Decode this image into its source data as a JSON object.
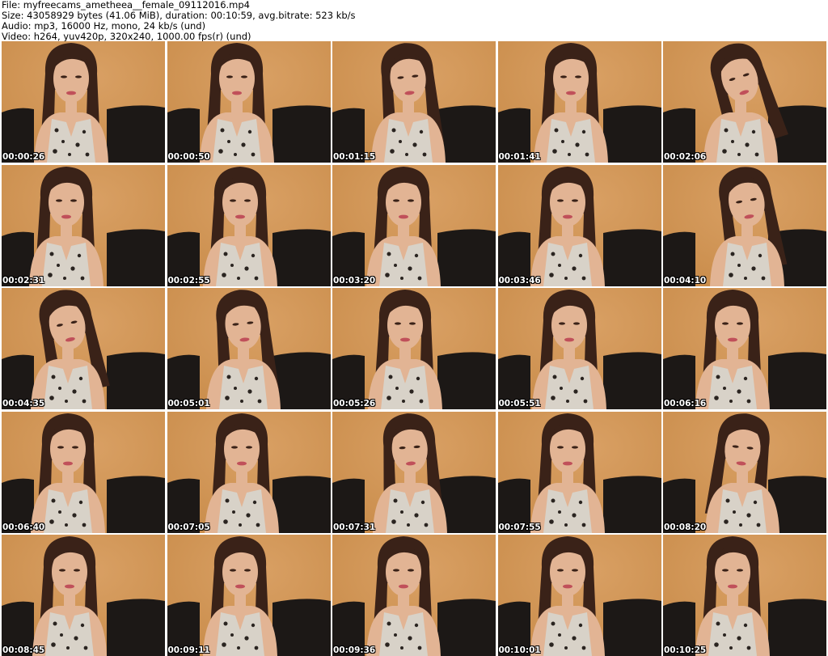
{
  "header": {
    "file_line": "File: myfreecams_ametheea__female_09112016.mp4",
    "size_line": "Size: 43058929 bytes (41.06 MiB), duration: 00:10:59, avg.bitrate: 523 kb/s",
    "audio_line": "Audio: mp3, 16000 Hz, mono, 24 kb/s (und)",
    "video_line": "Video: h264, yuv420p, 320x240, 1000.00 fps(r) (und)"
  },
  "frames": [
    {
      "timestamp": "00:00:26"
    },
    {
      "timestamp": "00:00:50"
    },
    {
      "timestamp": "00:01:15"
    },
    {
      "timestamp": "00:01:41"
    },
    {
      "timestamp": "00:02:06"
    },
    {
      "timestamp": "00:02:31"
    },
    {
      "timestamp": "00:02:55"
    },
    {
      "timestamp": "00:03:20"
    },
    {
      "timestamp": "00:03:46"
    },
    {
      "timestamp": "00:04:10"
    },
    {
      "timestamp": "00:04:35"
    },
    {
      "timestamp": "00:05:01"
    },
    {
      "timestamp": "00:05:26"
    },
    {
      "timestamp": "00:05:51"
    },
    {
      "timestamp": "00:06:16"
    },
    {
      "timestamp": "00:06:40"
    },
    {
      "timestamp": "00:07:05"
    },
    {
      "timestamp": "00:07:31"
    },
    {
      "timestamp": "00:07:55"
    },
    {
      "timestamp": "00:08:20"
    },
    {
      "timestamp": "00:08:45"
    },
    {
      "timestamp": "00:09:11"
    },
    {
      "timestamp": "00:09:36"
    },
    {
      "timestamp": "00:10:01"
    },
    {
      "timestamp": "00:10:25"
    }
  ],
  "colors": {
    "wall": "#c98c4a",
    "wall_highlight": "#d9a064",
    "couch": "#1c1816",
    "hair": "#3a2218",
    "skin": "#e2b494",
    "dress_base": "#d8d2c8",
    "dress_spots": "#2a2420",
    "lips": "#c0505a",
    "timestamp_text": "#ffffff"
  }
}
